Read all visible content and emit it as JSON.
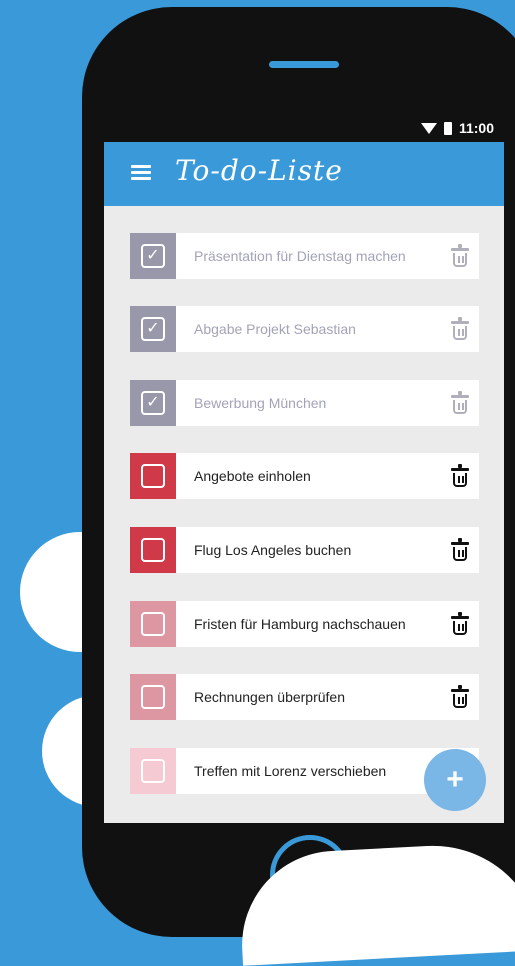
{
  "status_bar": {
    "time": "11:00",
    "icons": [
      "wifi-icon",
      "battery-icon"
    ]
  },
  "app_bar": {
    "title": "To-do-Liste",
    "menu_icon": "menu-icon"
  },
  "colors": {
    "background": "#3a9ad9",
    "app_bar": "#3a9ad9",
    "done": "#9898aa",
    "priority_high": "#d03a48",
    "priority_medium": "#dd97a3",
    "priority_low": "#f6cad2",
    "fab": "#7ab6e6"
  },
  "tasks": [
    {
      "label": "Präsentation für Dienstag machen",
      "done": true,
      "color": "#9898aa"
    },
    {
      "label": "Abgabe Projekt Sebastian",
      "done": true,
      "color": "#9898aa"
    },
    {
      "label": "Bewerbung München",
      "done": true,
      "color": "#9898aa"
    },
    {
      "label": "Angebote einholen",
      "done": false,
      "color": "#d03a48"
    },
    {
      "label": "Flug Los Angeles buchen",
      "done": false,
      "color": "#d03a48"
    },
    {
      "label": "Fristen für Hamburg nachschauen",
      "done": false,
      "color": "#dd97a3"
    },
    {
      "label": "Rechnungen überprüfen",
      "done": false,
      "color": "#dd97a3"
    },
    {
      "label": "Treffen mit Lorenz verschieben",
      "done": false,
      "color": "#f6cad2"
    }
  ],
  "fab": {
    "label": "+"
  }
}
